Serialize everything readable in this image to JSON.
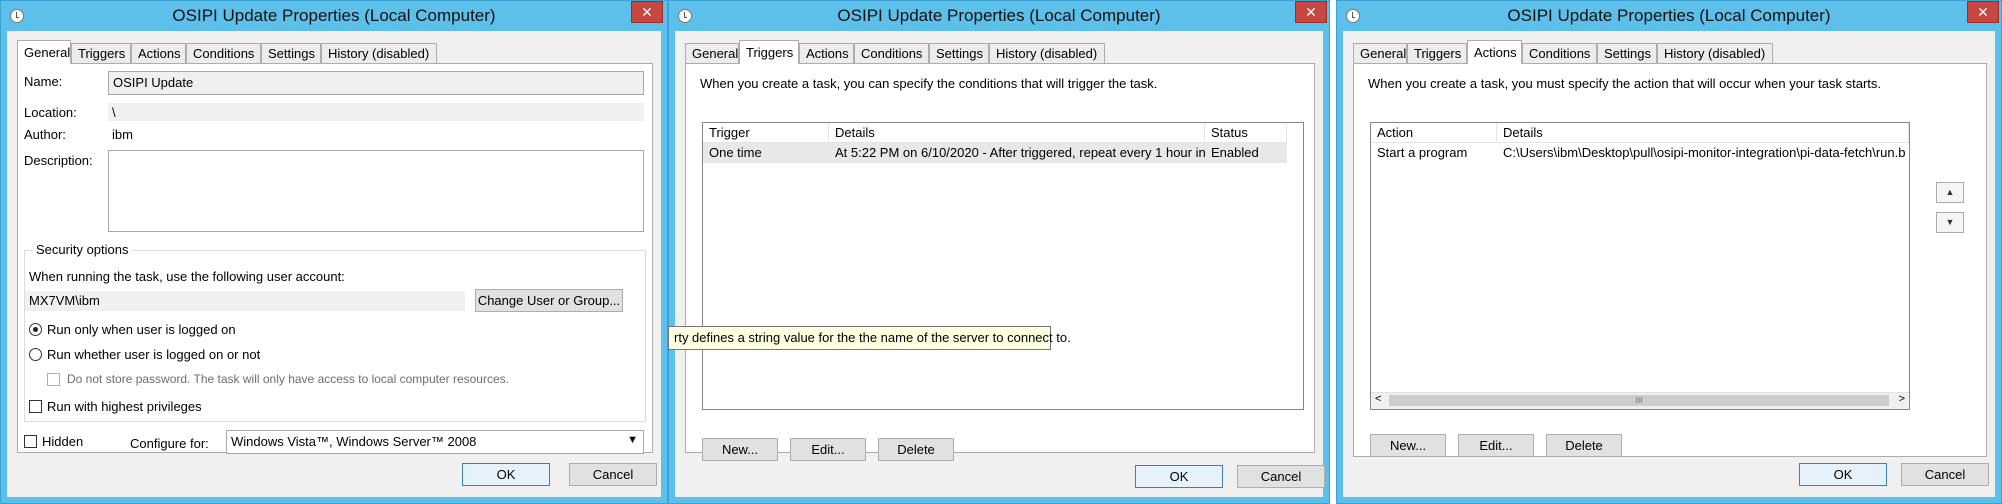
{
  "title": "OSIPI Update Properties (Local Computer)",
  "close_glyph": "✕",
  "tabs": [
    "General",
    "Triggers",
    "Actions",
    "Conditions",
    "Settings",
    "History (disabled)"
  ],
  "general": {
    "name_label": "Name:",
    "name_value": "OSIPI Update",
    "location_label": "Location:",
    "location_value": "\\",
    "author_label": "Author:",
    "author_value": "ibm",
    "description_label": "Description:",
    "security_title": "Security options",
    "run_as_prompt": "When running the task, use the following user account:",
    "account": "MX7VM\\ibm",
    "change_user_button": "Change User or Group...",
    "radio_logged_on": "Run only when user is logged on",
    "radio_whether": "Run whether user is logged on or not",
    "no_store_password": "Do not store password.  The task will only have access to local computer resources.",
    "highest_priv": "Run with highest privileges",
    "hidden": "Hidden",
    "configure_label": "Configure for:",
    "configure_value": "Windows Vista™, Windows Server™ 2008"
  },
  "triggers": {
    "intro": "When you create a task, you can specify the conditions that will trigger the task.",
    "columns": [
      "Trigger",
      "Details",
      "Status"
    ],
    "rows": [
      {
        "trigger": "One time",
        "details": "At 5:22 PM on 6/10/2020 - After triggered, repeat every 1 hour in...",
        "status": "Enabled"
      }
    ],
    "tooltip": "rty defines a string value for the the name of the server to connect to."
  },
  "actions": {
    "intro": "When you create a task, you must specify the action that will occur when your task starts.",
    "columns": [
      "Action",
      "Details"
    ],
    "rows": [
      {
        "action": "Start a program",
        "details": "C:\\Users\\ibm\\Desktop\\pull\\osipi-monitor-integration\\pi-data-fetch\\run.b"
      }
    ],
    "up_glyph": "▲",
    "down_glyph": "▼",
    "scroll_left": "<",
    "scroll_right": ">",
    "scroll_thumb": "III"
  },
  "buttons": {
    "new": "New...",
    "edit": "Edit...",
    "delete": "Delete",
    "ok": "OK",
    "cancel": "Cancel"
  }
}
